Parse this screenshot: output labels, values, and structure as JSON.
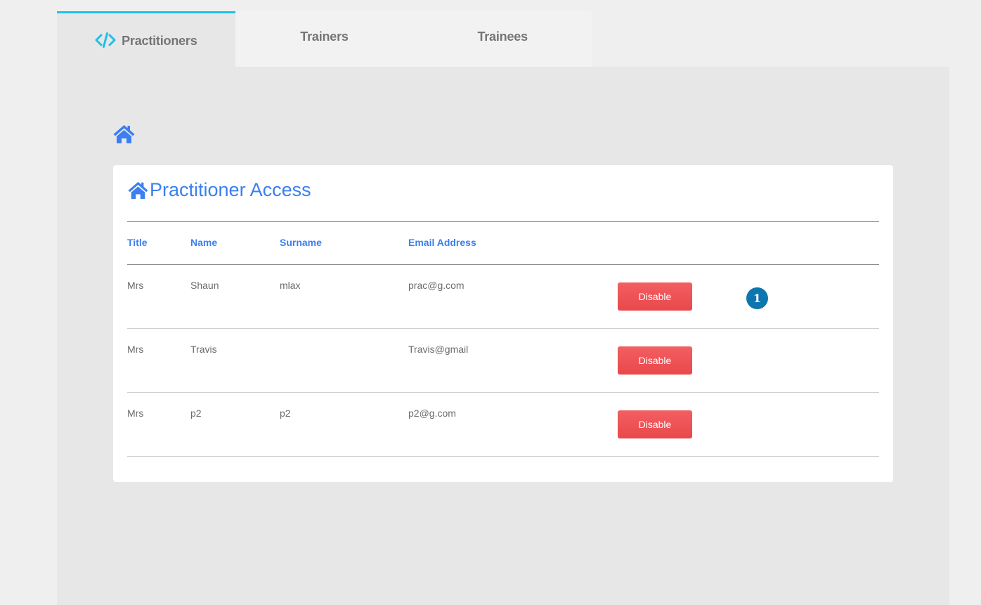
{
  "tabs": [
    {
      "label": "Practitioners",
      "icon": "code-icon",
      "active": true
    },
    {
      "label": "Trainers",
      "active": false
    },
    {
      "label": "Trainees",
      "active": false
    }
  ],
  "colors": {
    "accent": "#3b7ff0",
    "tab_indicator": "#1cc1e8",
    "disable_button": "#ef5558",
    "badge": "#0e76ae",
    "panel_bg": "#e7e7e7"
  },
  "breadcrumb": {
    "icon": "home-icon"
  },
  "card": {
    "title": "Practitioner Access",
    "icon": "home-icon"
  },
  "table": {
    "headers": [
      "Title",
      "Name",
      "Surname",
      "Email Address"
    ],
    "rows": [
      {
        "title": "Mrs",
        "name": "Shaun",
        "surname": "mlax",
        "email": "prac@g.com",
        "action": "Disable",
        "badge": "1"
      },
      {
        "title": "Mrs",
        "name": "Travis",
        "surname": "",
        "email": "Travis@gmail",
        "action": "Disable"
      },
      {
        "title": "Mrs",
        "name": "p2",
        "surname": "p2",
        "email": "p2@g.com",
        "action": "Disable"
      }
    ]
  }
}
